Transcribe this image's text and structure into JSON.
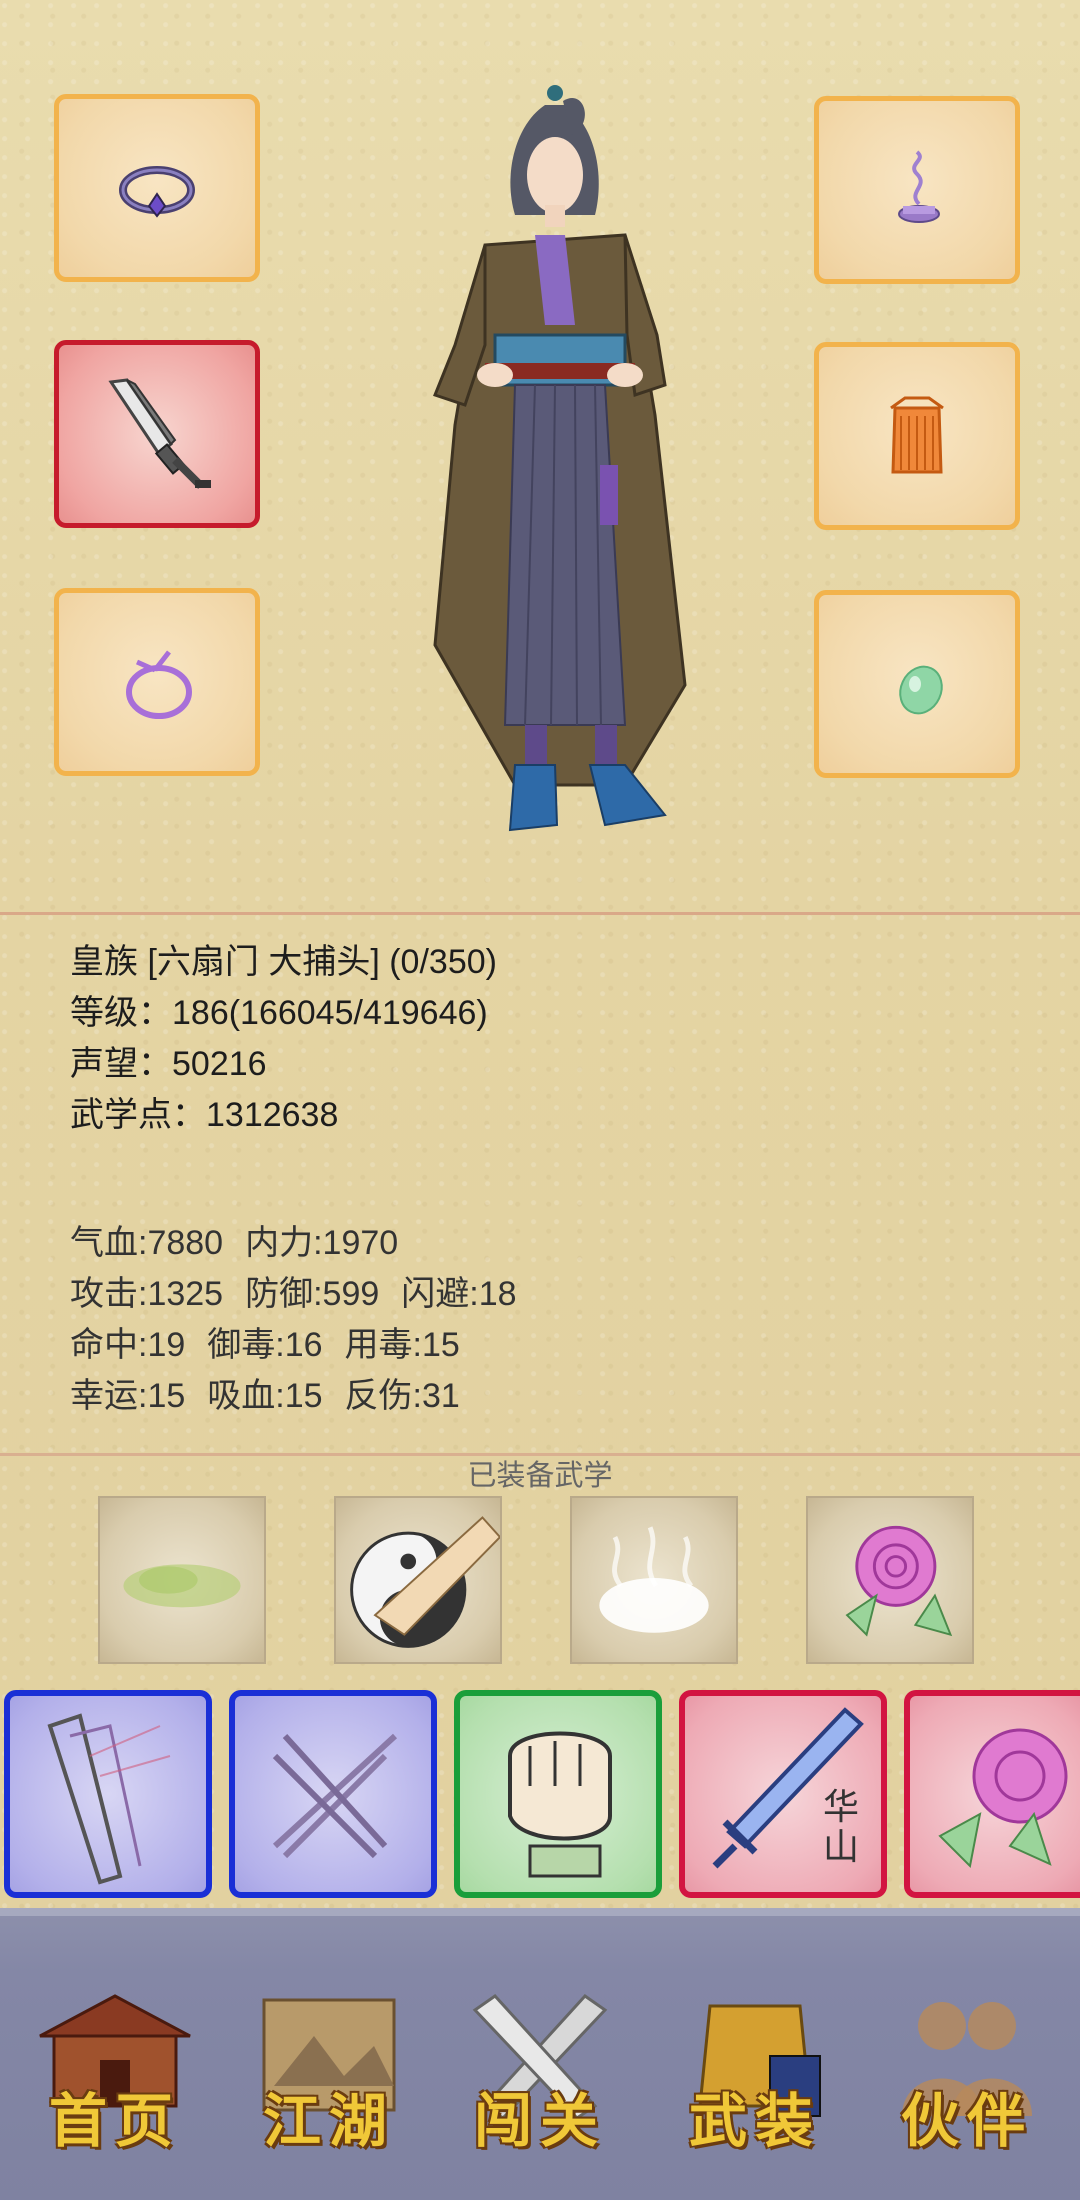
{
  "character": {
    "identity_line": "皇族 [六扇门 大捕头] (0/350)",
    "level_line": "等级：186(166045/419646)",
    "reputation_line": "声望：50216",
    "martial_points_line": "武学点：1312638"
  },
  "attributes": {
    "row1": [
      "气血:7880",
      "内力:1970"
    ],
    "row2": [
      "攻击:1325",
      "防御:599",
      "闪避:18"
    ],
    "row3": [
      "命中:19",
      "御毒:16",
      "用毒:15"
    ],
    "row4": [
      "幸运:15",
      "吸血:15",
      "反伤:31"
    ]
  },
  "equipped_skills_title": "已装备武学",
  "equipment_slots": [
    {
      "icon": "ring-icon"
    },
    {
      "icon": "broadsword-icon",
      "selected": true
    },
    {
      "icon": "bracelet-icon"
    },
    {
      "icon": "incense-icon"
    },
    {
      "icon": "robe-icon"
    },
    {
      "icon": "jade-icon"
    }
  ],
  "skill_cards_text": {
    "huashan": "华山"
  },
  "bottom_nav": [
    {
      "label": "首页",
      "icon": "house-icon"
    },
    {
      "label": "江湖",
      "icon": "scroll-map-icon"
    },
    {
      "label": "闯关",
      "icon": "crossed-swords-icon"
    },
    {
      "label": "武装",
      "icon": "armor-icon"
    },
    {
      "label": "伙伴",
      "icon": "companions-icon"
    }
  ],
  "colors": {
    "slot_border": "#f2b34c",
    "selected_border": "#c61b2c",
    "blue_card": "#1a2fd6",
    "green_card": "#1a9e3a",
    "red_card": "#d21441",
    "nav_text": "#f0c838"
  }
}
